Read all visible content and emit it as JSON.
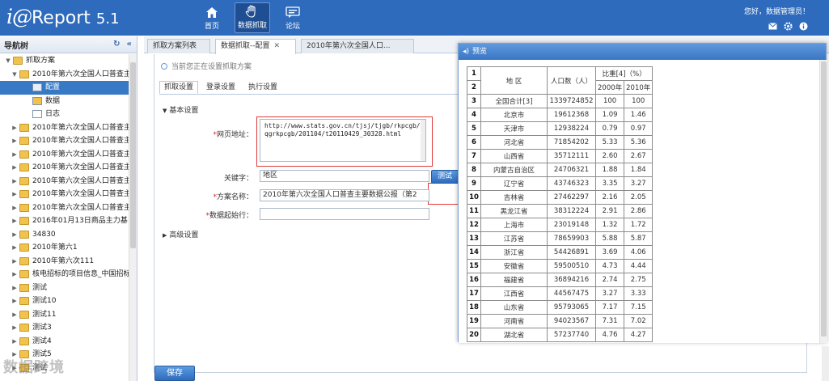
{
  "app": {
    "logo_main": "i@",
    "logo_rest": "Report",
    "version": "5.1"
  },
  "nav": [
    {
      "label": "首页",
      "icon": "home-icon"
    },
    {
      "label": "数据抓取",
      "icon": "hand-icon"
    },
    {
      "label": "论坛",
      "icon": "chat-icon"
    }
  ],
  "header": {
    "greeting": "您好，数据管理员！"
  },
  "sidebar": {
    "title": "导航树",
    "items": [
      {
        "label": "抓取方案",
        "level": 0,
        "type": "root",
        "expanded": true
      },
      {
        "label": "2010年第六次全国人口普查主",
        "level": 1,
        "type": "folder",
        "expanded": true
      },
      {
        "label": "配置",
        "level": 2,
        "type": "config",
        "selected": true
      },
      {
        "label": "数据",
        "level": 2,
        "type": "data"
      },
      {
        "label": "日志",
        "level": 2,
        "type": "log"
      },
      {
        "label": "2010年第六次全国人口普查主",
        "level": 1,
        "type": "folder"
      },
      {
        "label": "2010年第六次全国人口普查主",
        "level": 1,
        "type": "folder"
      },
      {
        "label": "2010年第六次全国人口普查主",
        "level": 1,
        "type": "folder"
      },
      {
        "label": "2010年第六次全国人口普查主",
        "level": 1,
        "type": "folder"
      },
      {
        "label": "2010年第六次全国人口普查主",
        "level": 1,
        "type": "folder"
      },
      {
        "label": "2010年第六次全国人口普查主",
        "level": 1,
        "type": "folder"
      },
      {
        "label": "2010年第六次全国人口普查主",
        "level": 1,
        "type": "folder"
      },
      {
        "label": "2016年01月13日商品主力基",
        "level": 1,
        "type": "folder"
      },
      {
        "label": "34830",
        "level": 1,
        "type": "folder"
      },
      {
        "label": "2010年第六1",
        "level": 1,
        "type": "folder"
      },
      {
        "label": "2010年第六次111",
        "level": 1,
        "type": "folder"
      },
      {
        "label": "核电招标的项目信息_中国招标",
        "level": 1,
        "type": "folder"
      },
      {
        "label": "测试",
        "level": 1,
        "type": "folder"
      },
      {
        "label": "测试10",
        "level": 1,
        "type": "folder"
      },
      {
        "label": "测试11",
        "level": 1,
        "type": "folder"
      },
      {
        "label": "测试3",
        "level": 1,
        "type": "folder"
      },
      {
        "label": "测试4",
        "level": 1,
        "type": "folder"
      },
      {
        "label": "测试5",
        "level": 1,
        "type": "folder"
      },
      {
        "label": "测试",
        "level": 1,
        "type": "folder"
      }
    ]
  },
  "tabs": [
    {
      "label": "抓取方案列表",
      "active": false,
      "closable": false
    },
    {
      "label": "数据抓取--配置",
      "active": true,
      "closable": true
    },
    {
      "label": "2010年第六次全国人口...",
      "active": false,
      "closable": false
    }
  ],
  "hint": "当前您正在设置抓取方案",
  "subtabs": [
    "抓取设置",
    "登录设置",
    "执行设置"
  ],
  "sections": {
    "basic": "基本设置",
    "advanced": "高级设置"
  },
  "form": {
    "url_label": "网页地址：",
    "url_value": "http://www.stats.gov.cn/tjsj/tjgb/rkpcgb/qgrkpcgb/201104/t20110429_30328.html",
    "keyword_label": "关键字：",
    "keyword_value": "地区",
    "test_button": "测试",
    "name_label": "方案名称：",
    "name_value": "2010年第六次全国人口普查主要数据公报（第2",
    "start_row_label": "数据起始行：",
    "start_row_value": "",
    "required_mark": "*"
  },
  "save_button": "保存",
  "watermark": "数据跨境",
  "preview": {
    "title": "预览",
    "header": {
      "region": "地 区",
      "population": "人口数（人）",
      "ratio": "比重[4]（%）",
      "y2000": "2000年",
      "y2010": "2010年"
    },
    "rows": [
      {
        "n": "3",
        "region": "全国合计[3]",
        "pop": "1339724852",
        "y2000": "100",
        "y2010": "100"
      },
      {
        "n": "4",
        "region": "北京市",
        "pop": "19612368",
        "y2000": "1.09",
        "y2010": "1.46"
      },
      {
        "n": "5",
        "region": "天津市",
        "pop": "12938224",
        "y2000": "0.79",
        "y2010": "0.97"
      },
      {
        "n": "6",
        "region": "河北省",
        "pop": "71854202",
        "y2000": "5.33",
        "y2010": "5.36"
      },
      {
        "n": "7",
        "region": "山西省",
        "pop": "35712111",
        "y2000": "2.60",
        "y2010": "2.67"
      },
      {
        "n": "8",
        "region": "内蒙古自治区",
        "pop": "24706321",
        "y2000": "1.88",
        "y2010": "1.84"
      },
      {
        "n": "9",
        "region": "辽宁省",
        "pop": "43746323",
        "y2000": "3.35",
        "y2010": "3.27"
      },
      {
        "n": "10",
        "region": "吉林省",
        "pop": "27462297",
        "y2000": "2.16",
        "y2010": "2.05"
      },
      {
        "n": "11",
        "region": "黑龙江省",
        "pop": "38312224",
        "y2000": "2.91",
        "y2010": "2.86"
      },
      {
        "n": "12",
        "region": "上海市",
        "pop": "23019148",
        "y2000": "1.32",
        "y2010": "1.72"
      },
      {
        "n": "13",
        "region": "江苏省",
        "pop": "78659903",
        "y2000": "5.88",
        "y2010": "5.87"
      },
      {
        "n": "14",
        "region": "浙江省",
        "pop": "54426891",
        "y2000": "3.69",
        "y2010": "4.06"
      },
      {
        "n": "15",
        "region": "安徽省",
        "pop": "59500510",
        "y2000": "4.73",
        "y2010": "4.44"
      },
      {
        "n": "16",
        "region": "福建省",
        "pop": "36894216",
        "y2000": "2.74",
        "y2010": "2.75"
      },
      {
        "n": "17",
        "region": "江西省",
        "pop": "44567475",
        "y2000": "3.27",
        "y2010": "3.33"
      },
      {
        "n": "18",
        "region": "山东省",
        "pop": "95793065",
        "y2000": "7.17",
        "y2010": "7.15"
      },
      {
        "n": "19",
        "region": "河南省",
        "pop": "94023567",
        "y2000": "7.31",
        "y2010": "7.02"
      },
      {
        "n": "20",
        "region": "湖北省",
        "pop": "57237740",
        "y2000": "4.76",
        "y2010": "4.27"
      }
    ]
  }
}
